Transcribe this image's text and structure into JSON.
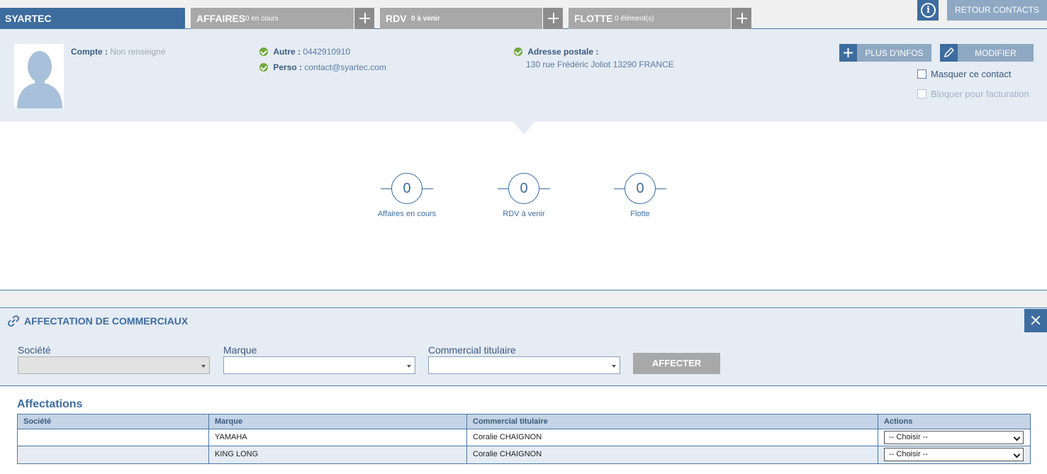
{
  "topbar": {
    "company": "SYARTEC",
    "tabs": [
      {
        "title": "AFFAIRES",
        "sub": "0 en cours"
      },
      {
        "title": "RDV",
        "sub": "0 à venir"
      },
      {
        "title": "FLOTTE",
        "sub": "0 élément(s)"
      }
    ],
    "info_icon": "info-icon",
    "retour_label": "RETOUR CONTACTS"
  },
  "contact": {
    "compte_label": "Compte :",
    "compte_value": "Non renseigné",
    "autre_label": "Autre :",
    "autre_value": "0442910910",
    "perso_label": "Perso :",
    "perso_value": "contact@syartec.com",
    "adresse_label": "Adresse postale :",
    "adresse_value": "130 rue Frédéric Joliot  13290 FRANCE",
    "plus_infos_label": "PLUS D'INFOS",
    "modifier_label": "MODIFIER",
    "masquer_label": "Masquer ce contact",
    "bloquer_label": "Bloquer pour facturation"
  },
  "counters": [
    {
      "value": "0",
      "label": "Affaires en cours"
    },
    {
      "value": "0",
      "label": "RDV à venir"
    },
    {
      "value": "0",
      "label": "Flotte"
    }
  ],
  "affectation": {
    "title": "AFFECTATION DE COMMERCIAUX",
    "societe_label": "Société",
    "marque_label": "Marque",
    "commercial_label": "Commercial titulaire",
    "affecter_label": "AFFECTER",
    "list_title": "Affectations",
    "columns": [
      "Société",
      "Marque",
      "Commercial titulaire",
      "Actions"
    ],
    "rows": [
      {
        "societe": "",
        "marque": "YAMAHA",
        "commercial": "Coralie CHAIGNON",
        "action": "-- Choisir --"
      },
      {
        "societe": "",
        "marque": "KING LONG",
        "commercial": "Coralie CHAIGNON",
        "action": "-- Choisir --"
      }
    ]
  },
  "colors": {
    "primary": "#3d6c9e",
    "light_panel": "#e6ecf4",
    "tab_grey": "#a8a8a8",
    "check_green": "#6fa83a"
  }
}
